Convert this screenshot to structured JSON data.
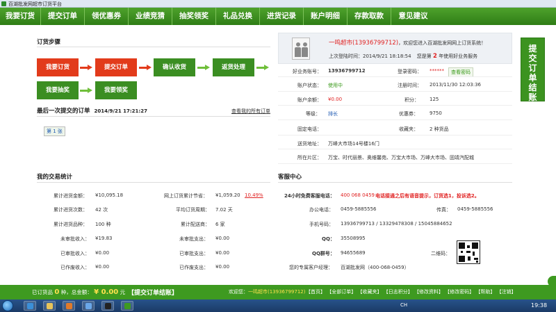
{
  "window": {
    "title": "百湖批发网超市订货平台"
  },
  "nav": [
    "我要订货",
    "提交订单",
    "领优惠券",
    "业绩竞猜",
    "抽奖领奖",
    "礼品兑换",
    "进货记录",
    "账户明细",
    "存款取款",
    "意见建议"
  ],
  "side_ad": {
    "label": "提交订单结账"
  },
  "steps": {
    "title": "订货步骤",
    "row1": [
      "我要订货",
      "提交订单",
      "确认收货",
      "返货处理"
    ],
    "row2": [
      "我要抽奖",
      "我要领奖"
    ]
  },
  "last_order": {
    "label": "最后一次提交的订单",
    "time": "2014/9/21 17:21:27",
    "view_all": "查看我的所有订单",
    "page_link": "第 1 张"
  },
  "welcome": {
    "store": "一鸣超市(13936799712)",
    "greeting": "，欢迎您进入百湖批发网网上订货系统！",
    "last_login_label": "上次登陆时间：",
    "last_login": "2014/9/21 18:18:54",
    "years_prefix": "您是第",
    "years": "2",
    "years_suffix": "年使用好业务服务"
  },
  "account": {
    "id_label": "好业务账号：",
    "id_value": "13936799712",
    "pwd_label": "登录密码：",
    "pwd_value": "******",
    "pwd_btn": "查看密码",
    "status_label": "账户状态：",
    "status_value": "使用中",
    "reg_label": "注册时间：",
    "reg_value": "2013/11/30 12:03:36",
    "balance_label": "账户余额：",
    "balance_value": "¥0.00",
    "points_label": "积分：",
    "points_value": "125",
    "level_label": "等级：",
    "level_value": "排长",
    "coupon_label": "优惠券：",
    "coupon_value": "9750",
    "phone_label": "固定电话：",
    "phone_value": "",
    "fav_label": "收藏夹：",
    "fav_value": "2 种货品",
    "addr_label": "送货地址：",
    "addr_value": "万峰大市场14号楼16门",
    "area_label": "所在片区：",
    "area_value": "万宝、时代丽景、奥维馨苑、万宝大市场、万峰大市场、固靖汽配城"
  },
  "stats": {
    "title": "我的交易统计",
    "rows": [
      [
        "累计进货金额：",
        "¥10,095.18",
        "网上订货累计节省：",
        "¥1,059.20",
        "10.49%"
      ],
      [
        "累计进货次数：",
        "42 次",
        "平均订货周期：",
        "7.02 天",
        ""
      ],
      [
        "累计进货品种：",
        "100 种",
        "累计配送商：",
        "6 家",
        ""
      ],
      [
        "未审批收入：",
        "¥19.83",
        "未审批支出：",
        "¥0.00",
        ""
      ],
      [
        "已审批收入：",
        "¥0.00",
        "已审批支出：",
        "¥0.00",
        ""
      ],
      [
        "已作废收入：",
        "¥0.00",
        "已作废支出：",
        "¥0.00",
        ""
      ]
    ]
  },
  "service": {
    "title": "客服中心",
    "hotline_label": "24小时免费客服电话：",
    "hotline_value": "400 068 0459",
    "hotline_note": "电话接通之后有语音提示，订货选1，投诉选2。",
    "office_label": "办公电话：",
    "office_value": "0459-5885556",
    "fax_label": "传真：",
    "fax_value": "0459-5885556",
    "mobile_label": "手机号码：",
    "mobile_value": "13936799713 / 13329478308 / 15045884652",
    "qq_label": "QQ：",
    "qq_value": "35508995",
    "qqgroup_label": "QQ群号：",
    "qqgroup_value": "94655689",
    "qrcode_label": "二维码：",
    "manager_label": "您的专属客户经理：",
    "manager_value": "百湖批发网（400-068-0459）"
  },
  "footer": {
    "goods_prefix": "已订货品",
    "goods_count": "0",
    "goods_mid": "种，总金额：",
    "total": "¥ 0.00",
    "total_unit": "元",
    "checkout": "【提交订单结账】",
    "welcome": "欢迎您：",
    "user": "一鸣超市(13936799712)",
    "links": [
      "【首页】",
      "【全部订单】",
      "【收藏夹】",
      "【日志积分】",
      "【修改资料】",
      "【修改密码】",
      "【帮助】",
      "【注销】"
    ]
  },
  "taskbar": {
    "lang": "CH",
    "clock": "19:38"
  },
  "colors": {
    "nav_green": "#3e9a20",
    "red_step": "#e23b1b",
    "green_step": "#3b8e22"
  }
}
